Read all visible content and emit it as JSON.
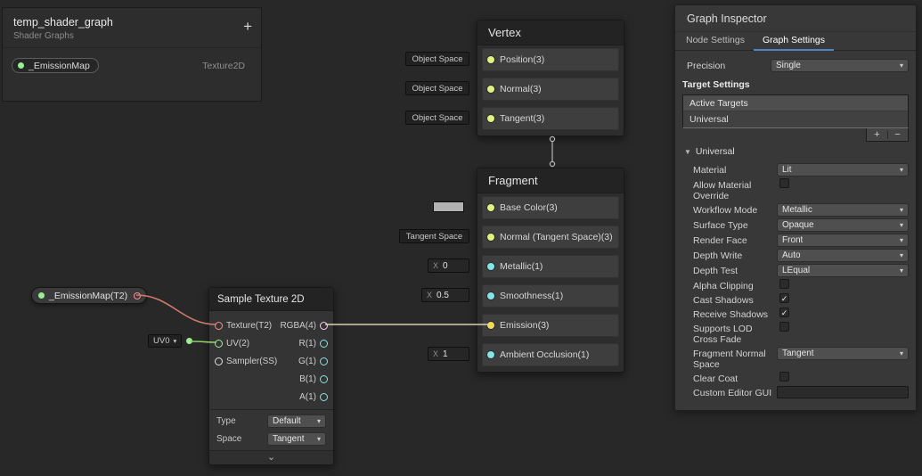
{
  "colors": {
    "accent_tab": "#4f83c2",
    "ports": {
      "v1": "#84e4e7",
      "v2": "#9aef92",
      "v3": "#dff283",
      "v3_emission": "#f0dc55",
      "v4": "#fbcbf4",
      "tex": "#ff8b8b",
      "sampler": "#e2e2e2"
    },
    "wires": {
      "texture": "#cf7a6e",
      "uv": "#8fce6a",
      "rgba": "#d9cfae",
      "vertex_link": "#b5b5b5"
    }
  },
  "icons": {
    "dropdown_arrow": "▾",
    "collapse_chevron": "⌄",
    "foldout_arrow": "▼",
    "check": "✓"
  },
  "blackboard": {
    "title": "temp_shader_graph",
    "subtitle": "Shader Graphs",
    "add_label": "+",
    "properties": [
      {
        "name": "_EmissionMap",
        "type": "Texture2D"
      }
    ]
  },
  "vertex_node": {
    "title": "Vertex",
    "ports": [
      {
        "label": "Position(3)",
        "type": "v3",
        "space_label": "Object Space"
      },
      {
        "label": "Normal(3)",
        "type": "v3",
        "space_label": "Object Space"
      },
      {
        "label": "Tangent(3)",
        "type": "v3",
        "space_label": "Object Space"
      }
    ]
  },
  "fragment_node": {
    "title": "Fragment",
    "ports": [
      {
        "label": "Base Color(3)",
        "type": "v3",
        "control": {
          "kind": "color"
        }
      },
      {
        "label": "Normal (Tangent Space)(3)",
        "type": "v3",
        "control": {
          "kind": "pill",
          "label": "Tangent Space"
        }
      },
      {
        "label": "Metallic(1)",
        "type": "v1",
        "control": {
          "kind": "float",
          "axis": "X",
          "value": "0"
        }
      },
      {
        "label": "Smoothness(1)",
        "type": "v1",
        "control": {
          "kind": "float",
          "axis": "X",
          "value": "0.5"
        }
      },
      {
        "label": "Emission(3)",
        "type": "v3_emission",
        "control": {
          "kind": "none"
        }
      },
      {
        "label": "Ambient Occlusion(1)",
        "type": "v1",
        "control": {
          "kind": "float",
          "axis": "X",
          "value": "1"
        }
      }
    ]
  },
  "emission_map_node": {
    "label": "_EmissionMap(T2)",
    "port_type": "tex"
  },
  "uv_dropdown": {
    "label": "UV0",
    "port_type": "v2"
  },
  "sample_texture_node": {
    "title": "Sample Texture 2D",
    "inputs": [
      {
        "label": "Texture(T2)",
        "type": "tex"
      },
      {
        "label": "UV(2)",
        "type": "v2"
      },
      {
        "label": "Sampler(SS)",
        "type": "sampler"
      }
    ],
    "outputs": [
      {
        "label": "RGBA(4)",
        "type": "v4"
      },
      {
        "label": "R(1)",
        "type": "v1"
      },
      {
        "label": "G(1)",
        "type": "v1"
      },
      {
        "label": "B(1)",
        "type": "v1"
      },
      {
        "label": "A(1)",
        "type": "v1"
      }
    ],
    "settings": [
      {
        "label": "Type",
        "value": "Default"
      },
      {
        "label": "Space",
        "value": "Tangent"
      }
    ]
  },
  "inspector": {
    "title": "Graph Inspector",
    "tabs": [
      {
        "label": "Node Settings",
        "active": false
      },
      {
        "label": "Graph Settings",
        "active": true
      }
    ],
    "precision_label": "Precision",
    "precision_value": "Single",
    "target_settings_label": "Target Settings",
    "active_targets_header": "Active Targets",
    "targets": [
      "Universal"
    ],
    "add_button": "+",
    "remove_button": "−",
    "universal_foldout": "Universal",
    "settings": [
      {
        "label": "Material",
        "type": "dropdown",
        "value": "Lit"
      },
      {
        "label": "Allow Material Override",
        "type": "checkbox",
        "checked": false
      },
      {
        "label": "Workflow Mode",
        "type": "dropdown",
        "value": "Metallic"
      },
      {
        "label": "Surface Type",
        "type": "dropdown",
        "value": "Opaque"
      },
      {
        "label": "Render Face",
        "type": "dropdown",
        "value": "Front"
      },
      {
        "label": "Depth Write",
        "type": "dropdown",
        "value": "Auto"
      },
      {
        "label": "Depth Test",
        "type": "dropdown",
        "value": "LEqual"
      },
      {
        "label": "Alpha Clipping",
        "type": "checkbox",
        "checked": false
      },
      {
        "label": "Cast Shadows",
        "type": "checkbox",
        "checked": true
      },
      {
        "label": "Receive Shadows",
        "type": "checkbox",
        "checked": true
      },
      {
        "label": "Supports LOD Cross Fade",
        "type": "checkbox",
        "checked": false
      },
      {
        "label": "Fragment Normal Space",
        "type": "dropdown",
        "value": "Tangent"
      },
      {
        "label": "Clear Coat",
        "type": "checkbox",
        "checked": false
      },
      {
        "label": "Custom Editor GUI",
        "type": "text",
        "value": ""
      }
    ]
  }
}
